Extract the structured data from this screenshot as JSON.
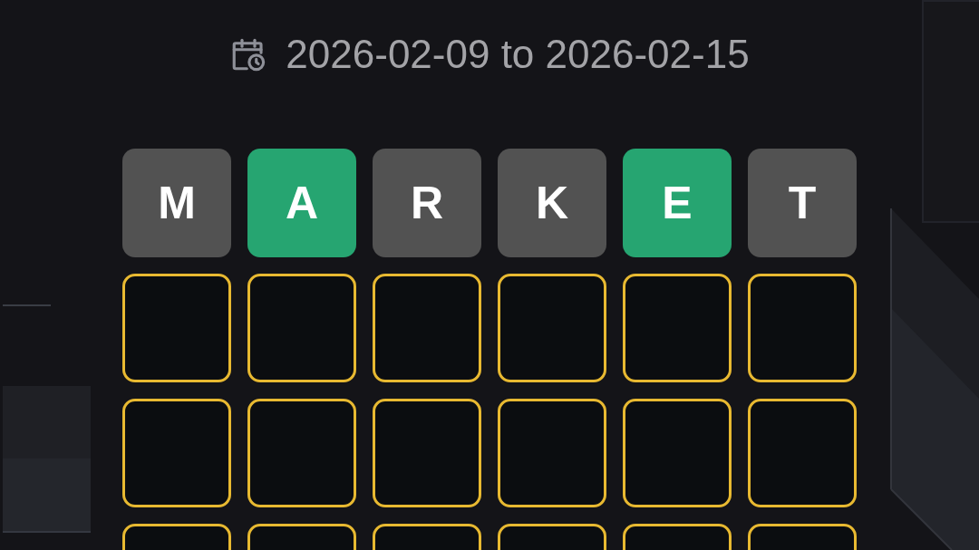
{
  "date_range": "2026-02-09 to 2026-02-15",
  "rows": [
    {
      "tiles": [
        {
          "letter": "M",
          "kind": "revealed",
          "color": "#525252"
        },
        {
          "letter": "A",
          "kind": "revealed",
          "color": "#26a571"
        },
        {
          "letter": "R",
          "kind": "revealed",
          "color": "#525252"
        },
        {
          "letter": "K",
          "kind": "revealed",
          "color": "#525252"
        },
        {
          "letter": "E",
          "kind": "revealed",
          "color": "#26a571"
        },
        {
          "letter": "T",
          "kind": "revealed",
          "color": "#525252"
        }
      ]
    },
    {
      "tiles": [
        {
          "kind": "empty"
        },
        {
          "kind": "empty"
        },
        {
          "kind": "empty"
        },
        {
          "kind": "empty"
        },
        {
          "kind": "empty"
        },
        {
          "kind": "empty"
        }
      ]
    },
    {
      "tiles": [
        {
          "kind": "empty"
        },
        {
          "kind": "empty"
        },
        {
          "kind": "empty"
        },
        {
          "kind": "empty"
        },
        {
          "kind": "empty"
        },
        {
          "kind": "empty"
        }
      ]
    },
    {
      "tiles": [
        {
          "kind": "empty"
        },
        {
          "kind": "empty"
        },
        {
          "kind": "empty"
        },
        {
          "kind": "empty"
        },
        {
          "kind": "empty"
        },
        {
          "kind": "empty"
        }
      ]
    }
  ]
}
